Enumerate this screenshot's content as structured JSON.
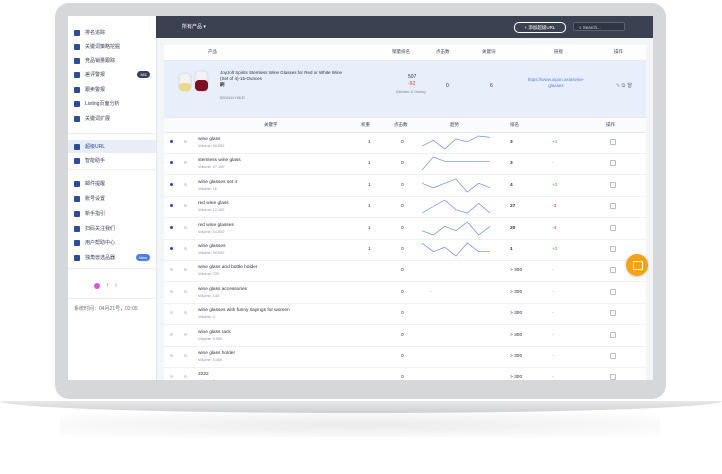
{
  "sidebar": {
    "items": [
      {
        "label": "排名追踪",
        "icon": "chart-icon"
      },
      {
        "label": "关键词策略挖掘",
        "icon": "search-icon"
      },
      {
        "label": "竞品销量跟踪",
        "icon": "search-icon"
      },
      {
        "label": "差评警报",
        "icon": "heart-icon",
        "badge": "461"
      },
      {
        "label": "跟卖警报",
        "icon": "list-icon"
      },
      {
        "label": "Listing页面分析",
        "icon": "eye-icon"
      },
      {
        "label": "关键词扩展",
        "icon": "expand-icon"
      },
      {
        "label": "超级URL",
        "icon": "link-icon"
      },
      {
        "label": "智能助手",
        "icon": "bot-icon"
      },
      {
        "label": "邮件提醒",
        "icon": "mail-icon"
      },
      {
        "label": "账号设置",
        "icon": "gear-icon"
      },
      {
        "label": "新手指引",
        "icon": "video-icon"
      },
      {
        "label": "扫码关注我们",
        "icon": "qr-icon"
      },
      {
        "label": "用户帮助中心",
        "icon": "help-icon"
      },
      {
        "label": "独角兽选品器",
        "icon": "info-icon",
        "badge": "New"
      }
    ],
    "active_index": 7,
    "footer_note": "系统时间：04月21号，02:05"
  },
  "topbar": {
    "product_dropdown": "所有产品",
    "add_button": "+ 添加超级URL",
    "search_placeholder": "Search..."
  },
  "table_header": {
    "product": "产品",
    "sales_rank": "销量排名",
    "clicks": "点击数",
    "keywords": "关键词",
    "link": "链接",
    "actions": "操作"
  },
  "product": {
    "title": "JoyJolt Spirits Stemless Wine Glasses for Red or White Wine (Set of 4)-15-Ounces",
    "tag": "刷",
    "id": "B01N11Y0KD",
    "rank": "507",
    "rank_change": "-92",
    "rank_category": "Kitchen & Dining",
    "clicks": "0",
    "keywords_count": "6",
    "link": "https://www.xipon.asia/wine-glasses"
  },
  "kw_header": {
    "keyword": "关键字",
    "weight": "权重",
    "clicks": "点击数",
    "trend": "趋势",
    "rank": "排名",
    "actions": "操作"
  },
  "keywords": [
    {
      "name": "wine glass",
      "volume": "Volume: 90,900",
      "weight": "1",
      "clicks": "0",
      "trend": [
        5,
        9,
        3,
        10,
        8,
        12,
        11
      ],
      "rank": "3",
      "change": "+1",
      "change_type": "pos",
      "starred": true
    },
    {
      "name": "stemless wine glass",
      "volume": "Volume: 27,100",
      "weight": "1",
      "clicks": "0",
      "trend": [
        3,
        9,
        7,
        7,
        7,
        7,
        7
      ],
      "rank": "3",
      "change": "-",
      "change_type": "neutral",
      "starred": true
    },
    {
      "name": "wine glasses set 4",
      "volume": "Volume: 1k",
      "weight": "1",
      "clicks": "0",
      "trend": [
        7,
        6,
        7,
        8,
        5,
        7,
        6
      ],
      "rank": "4",
      "change": "+2",
      "change_type": "pos",
      "starred": true
    },
    {
      "name": "red wine glass",
      "volume": "Volume: 12,100",
      "weight": "1",
      "clicks": "0",
      "trend": [
        6,
        8,
        10,
        7,
        6,
        9,
        6
      ],
      "rank": "27",
      "change": "-3",
      "change_type": "neg",
      "starred": true
    },
    {
      "name": "red wine glasses",
      "volume": "Volume: 14,800",
      "weight": "1",
      "clicks": "0",
      "trend": [
        7,
        6,
        8,
        7,
        9,
        6,
        8
      ],
      "rank": "20",
      "change": "-4",
      "change_type": "neg",
      "starred": true
    },
    {
      "name": "wine glasses",
      "volume": "Volume: 90,900",
      "weight": "1",
      "clicks": "0",
      "trend": [
        8,
        6,
        7,
        5,
        8,
        6,
        6
      ],
      "rank": "1",
      "change": "+2",
      "change_type": "pos",
      "starred": true
    },
    {
      "name": "wine glass and bottle holder",
      "volume": "Volume: 720",
      "weight": "",
      "clicks": "0",
      "trend": null,
      "rank": "> 300",
      "change": "-",
      "change_type": "neutral",
      "starred": false
    },
    {
      "name": "wine glass accessories",
      "volume": "Volume: 140",
      "weight": "",
      "clicks": "0",
      "trend": "dash",
      "rank": "> 300",
      "change": "-",
      "change_type": "neutral",
      "starred": false
    },
    {
      "name": "wine glasses with funny sayings for women",
      "volume": "Volume: 0",
      "weight": "",
      "clicks": "0",
      "trend": null,
      "rank": "> 300",
      "change": "-",
      "change_type": "neutral",
      "starred": false
    },
    {
      "name": "wine glass rack",
      "volume": "Volume: 9,900",
      "weight": "",
      "clicks": "0",
      "trend": null,
      "rank": "> 300",
      "change": "-",
      "change_type": "neutral",
      "starred": false
    },
    {
      "name": "wine glass holder",
      "volume": "Volume: 5,400",
      "weight": "",
      "clicks": "0",
      "trend": null,
      "rank": "> 300",
      "change": "-",
      "change_type": "neutral",
      "starred": false
    },
    {
      "name": "2222",
      "volume": "Volume: 0",
      "weight": "",
      "clicks": "0",
      "trend": null,
      "rank": "> 300",
      "change": "-",
      "change_type": "neutral",
      "starred": false
    }
  ],
  "colors": {
    "topbar": "#3b4150",
    "accent": "#2b4c9a",
    "link": "#4f7de8",
    "positive": "#2eae4d",
    "negative": "#d9363e",
    "chat": "#f4a21a"
  }
}
